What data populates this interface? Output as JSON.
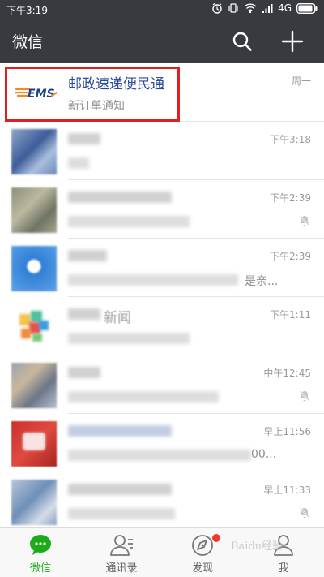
{
  "status_bar": {
    "time": "下午3:19",
    "network": "4G",
    "icons": [
      "alarm-icon",
      "vibrate-icon",
      "wifi-icon",
      "signal-icon",
      "battery-icon"
    ]
  },
  "nav": {
    "title": "微信",
    "search_icon": "search-icon",
    "add_icon": "plus-icon"
  },
  "chats": [
    {
      "title": "邮政速递便民通",
      "subtitle": "新订单通知",
      "time": "周一",
      "avatar": "ems-logo",
      "muted": false,
      "highlighted": true
    },
    {
      "title": "",
      "subtitle": "",
      "time": "下午3:18",
      "avatar": "blurred",
      "muted": false
    },
    {
      "title": "",
      "subtitle": "",
      "time": "下午2:39",
      "avatar": "blurred",
      "muted": true
    },
    {
      "title": "",
      "subtitle": "是亲...",
      "time": "下午2:39",
      "avatar": "blurred",
      "muted": false
    },
    {
      "title": "新闻",
      "subtitle": "",
      "time": "下午1:11",
      "avatar": "blurred",
      "muted": false
    },
    {
      "title": "",
      "subtitle": "",
      "time": "中午12:45",
      "avatar": "blurred",
      "muted": true
    },
    {
      "title": "",
      "subtitle": "00...",
      "time": "早上11:56",
      "avatar": "blurred",
      "muted": false
    },
    {
      "title": "",
      "subtitle": "",
      "time": "早上11:33",
      "avatar": "blurred",
      "muted": true
    }
  ],
  "tabs": [
    {
      "label": "微信",
      "icon": "chat-bubble-icon",
      "active": true
    },
    {
      "label": "通讯录",
      "icon": "contacts-icon",
      "active": false
    },
    {
      "label": "发现",
      "icon": "compass-icon",
      "active": false,
      "badge": true
    },
    {
      "label": "我",
      "icon": "person-icon",
      "active": false
    }
  ],
  "watermark": "Baidu经验",
  "colors": {
    "nav_bg": "#393a3f",
    "accent_green": "#1aad19",
    "highlight_red": "#e02020",
    "ems_blue": "#1e3f8f",
    "ems_orange": "#f08a24"
  }
}
